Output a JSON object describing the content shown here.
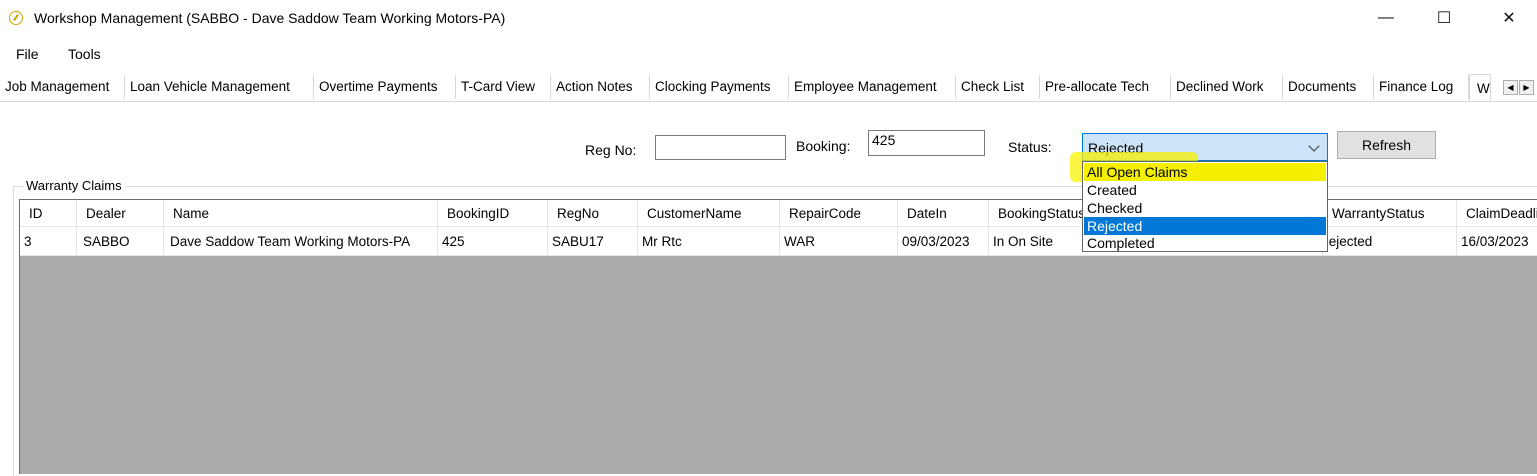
{
  "window": {
    "title": "Workshop Management  (SABBO - Dave Saddow Team Working Motors-PA)",
    "minimize_glyph": "—",
    "maximize_glyph": "☐",
    "close_glyph": "✕"
  },
  "menu": {
    "file": "File",
    "tools": "Tools"
  },
  "tabs": [
    "Job Management",
    "Loan Vehicle Management",
    "Overtime Payments",
    "T-Card View",
    "Action Notes",
    "Clocking Payments",
    "Employee Management",
    "Check List",
    "Pre-allocate Tech",
    "Declined Work",
    "Documents",
    "Finance Log"
  ],
  "active_tab_partial": "Wa",
  "tab_scroll": {
    "left": "◀",
    "right": "▶"
  },
  "filters": {
    "reg_label": "Reg No:",
    "reg_value": "",
    "booking_label": "Booking:",
    "booking_value": "425",
    "status_label": "Status:",
    "status_value": "Rejected",
    "refresh_label": "Refresh"
  },
  "status_options": [
    "All Open Claims",
    "Created",
    "Checked",
    "Rejected",
    "Completed"
  ],
  "group_title": "Warranty Claims",
  "grid": {
    "columns": [
      "ID",
      "Dealer",
      "Name",
      "BookingID",
      "RegNo",
      "CustomerName",
      "RepairCode",
      "DateIn",
      "BookingStatus",
      "WarrantyStatus",
      "ClaimDeadline"
    ],
    "rows": [
      [
        "3",
        "SABBO",
        "Dave Saddow Team Working Motors-PA",
        "425",
        "SABU17",
        "Mr Rtc",
        "WAR",
        "09/03/2023",
        "In On Site",
        "Rejected",
        "16/03/2023"
      ]
    ]
  },
  "colors": {
    "highlight": "#f4f000",
    "selection": "#0078d7",
    "grid_background": "#ababab"
  }
}
